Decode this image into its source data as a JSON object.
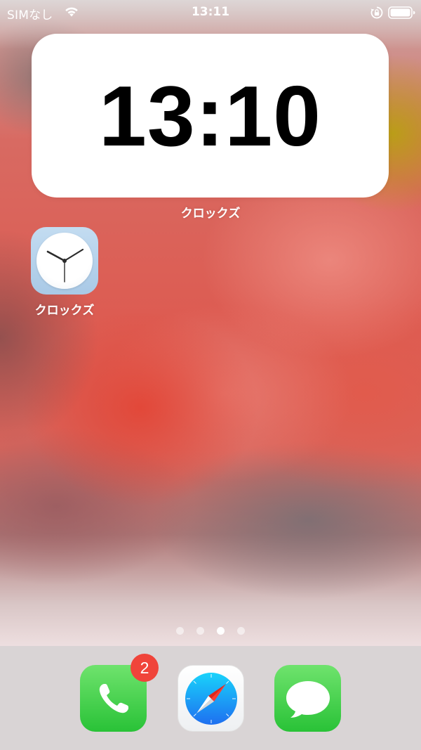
{
  "status_bar": {
    "carrier": "SIMなし",
    "time": "13:11",
    "icons": [
      "wifi-icon",
      "rotation-lock-icon",
      "battery-icon"
    ]
  },
  "widget": {
    "time": "13:10",
    "label": "クロックズ"
  },
  "home_apps": [
    {
      "label": "クロックズ",
      "icon": "clock-icon"
    }
  ],
  "page_indicator": {
    "count": 4,
    "active_index": 2
  },
  "dock": {
    "apps": [
      {
        "app": "phone",
        "icon": "phone-icon",
        "badge": "2",
        "accent": "#34c759"
      },
      {
        "app": "safari",
        "icon": "compass-icon",
        "accent": "#1a8cff"
      },
      {
        "app": "messages",
        "icon": "speech-bubble-icon",
        "accent": "#34c759"
      }
    ]
  },
  "colors": {
    "badge": "#f0443a"
  }
}
